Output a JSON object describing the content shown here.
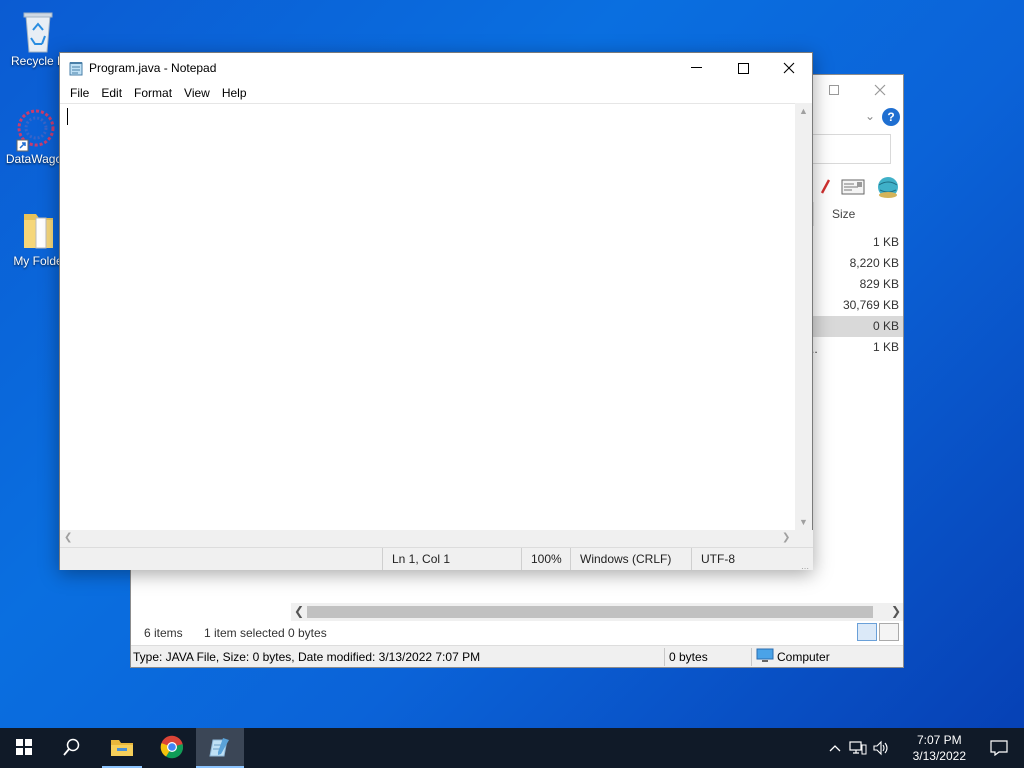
{
  "desktop": {
    "icons": [
      {
        "label": "Recycle B",
        "icon": "recycle-bin-icon"
      },
      {
        "label": "DataWago",
        "icon": "datawagon-icon"
      },
      {
        "label": "My Folde",
        "icon": "folder-icon"
      }
    ]
  },
  "notepad": {
    "title": "Program.java - Notepad",
    "menu": [
      "File",
      "Edit",
      "Format",
      "View",
      "Help"
    ],
    "content": "",
    "status": {
      "position": "Ln 1, Col 1",
      "zoom": "100%",
      "line_ending": "Windows (CRLF)",
      "encoding": "UTF-8"
    }
  },
  "explorer": {
    "column_header": "Size",
    "sizes": [
      "1 KB",
      "8,220 KB",
      "829 KB",
      "30,769 KB",
      "0 KB",
      "1 KB"
    ],
    "selected_index": 4,
    "truncated_marker": "..",
    "status_bar": {
      "items": "6 items",
      "selected": "1 item selected",
      "selected_size": "0 bytes"
    },
    "details_bar": {
      "info": "Type: JAVA File, Size: 0 bytes, Date modified: 3/13/2022 7:07 PM",
      "size": "0 bytes",
      "location": "Computer"
    }
  },
  "taskbar": {
    "time": "7:07 PM",
    "date": "3/13/2022",
    "apps": [
      "start-icon",
      "search-icon",
      "file-explorer-icon",
      "chrome-icon",
      "notepad-icon"
    ]
  },
  "colors": {
    "desktop_blue": "#0a6fe0",
    "taskbar": "#101a28",
    "accent": "#1f6fd1"
  }
}
